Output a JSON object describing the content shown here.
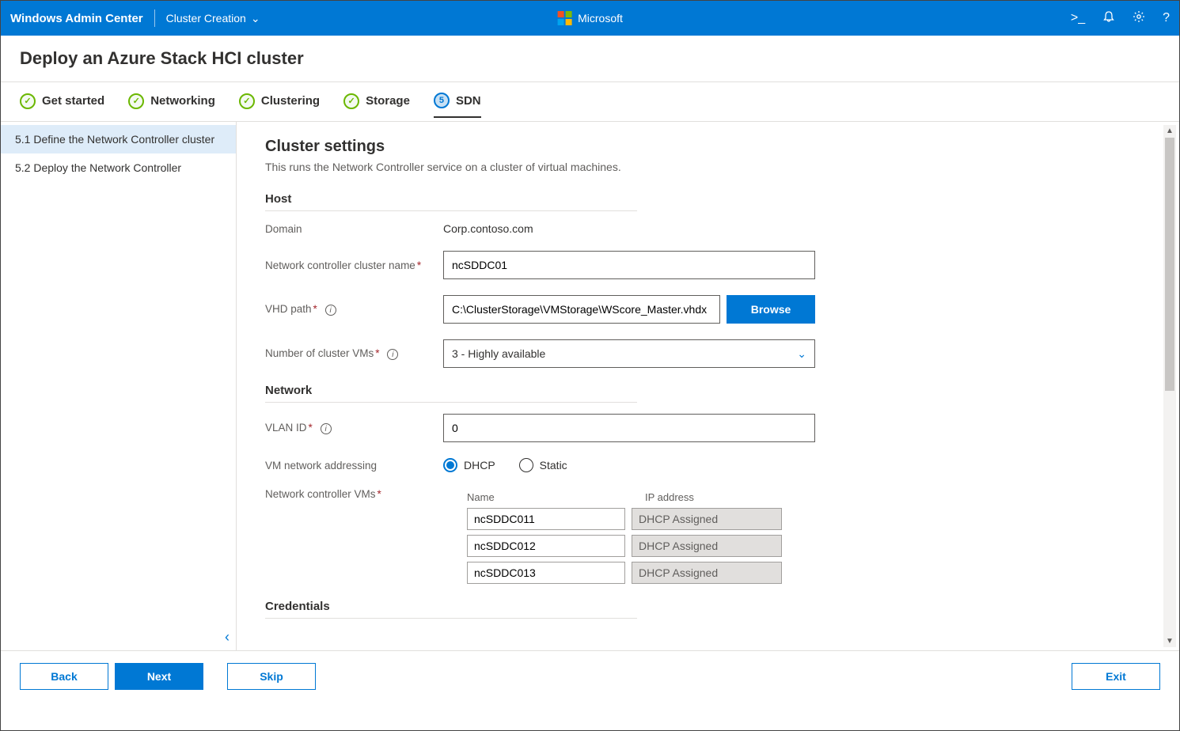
{
  "topbar": {
    "product": "Windows Admin Center",
    "context": "Cluster Creation",
    "brand": "Microsoft"
  },
  "page_title": "Deploy an Azure Stack HCI cluster",
  "steps": {
    "get_started": "Get started",
    "networking": "Networking",
    "clustering": "Clustering",
    "storage": "Storage",
    "sdn_num": "5",
    "sdn": "SDN",
    "check": "✓"
  },
  "sidenav": {
    "item1": "5.1  Define the Network Controller cluster",
    "item2": "5.2  Deploy the Network Controller"
  },
  "main": {
    "title": "Cluster settings",
    "subtitle": "This runs the Network Controller service on a cluster of virtual machines.",
    "host_section": "Host",
    "network_section": "Network",
    "credentials_section": "Credentials",
    "domain_label": "Domain",
    "domain_value": "Corp.contoso.com",
    "nc_name_label": "Network controller cluster name",
    "nc_name_value": "ncSDDC01",
    "vhd_label": "VHD path",
    "vhd_value": "C:\\ClusterStorage\\VMStorage\\WScore_Master.vhdx",
    "browse": "Browse",
    "numvm_label": "Number of cluster VMs",
    "numvm_value": "3 - Highly available",
    "vlan_label": "VLAN ID",
    "vlan_value": "0",
    "addressing_label": "VM network addressing",
    "radio_dhcp": "DHCP",
    "radio_static": "Static",
    "ncvms_label": "Network controller VMs",
    "col_name": "Name",
    "col_ip": "IP address",
    "vm1_name": "ncSDDC011",
    "vm1_ip": "DHCP Assigned",
    "vm2_name": "ncSDDC012",
    "vm2_ip": "DHCP Assigned",
    "vm3_name": "ncSDDC013",
    "vm3_ip": "DHCP Assigned"
  },
  "footer": {
    "back": "Back",
    "next": "Next",
    "skip": "Skip",
    "exit": "Exit"
  }
}
